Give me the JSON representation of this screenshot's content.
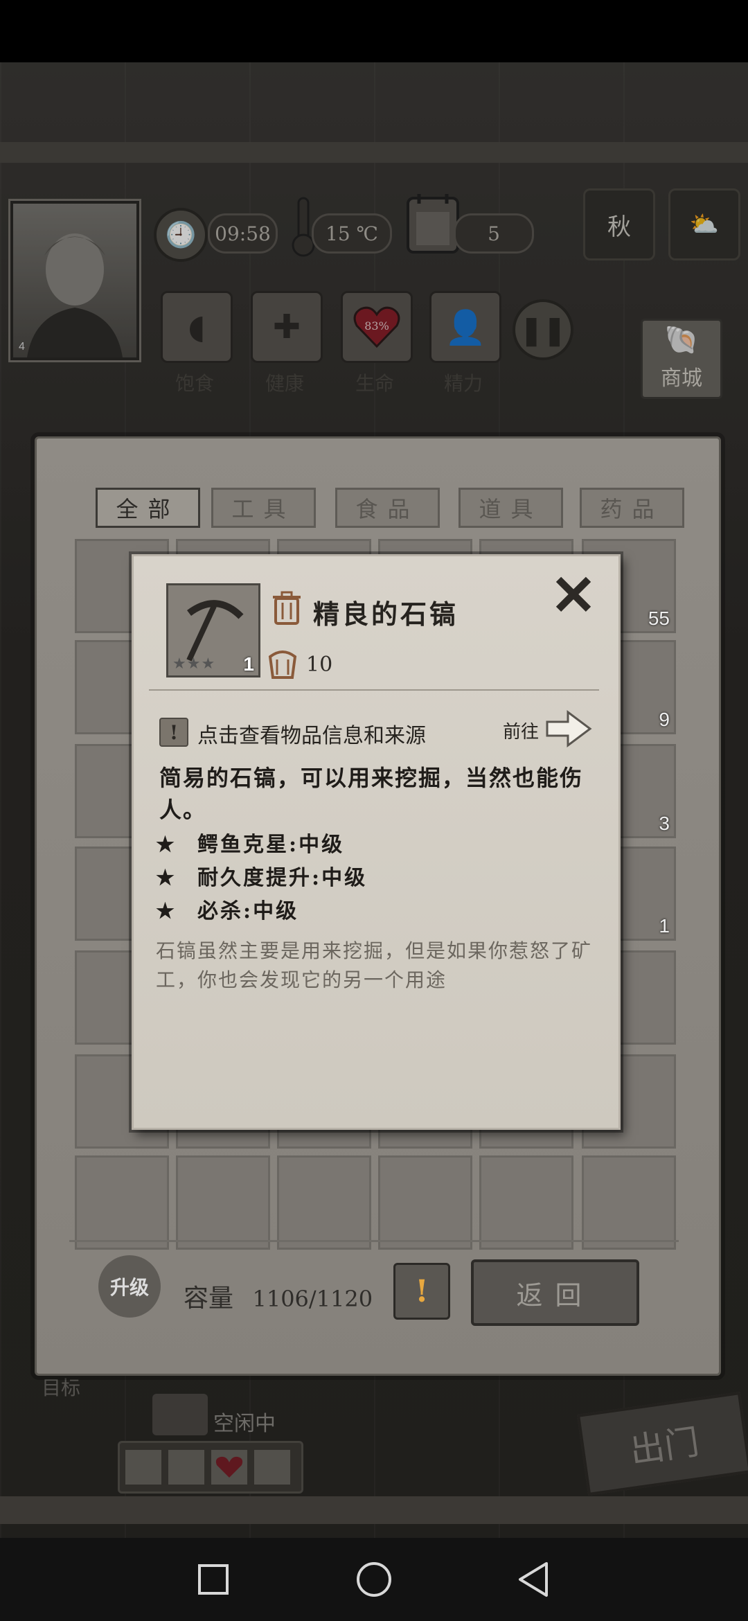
{
  "hud": {
    "portrait_level": "4",
    "time": "09:58",
    "temperature": "15 ℃",
    "day": "5",
    "season": "秋",
    "weather_icon": "cloudy-sun-icon",
    "stats": [
      {
        "label": "饱食",
        "icon": "stomach-icon"
      },
      {
        "label": "健康",
        "icon": "health-cross-icon"
      },
      {
        "label": "生命",
        "icon": "heart-icon",
        "value": "83%"
      },
      {
        "label": "精力",
        "icon": "person-icon"
      }
    ],
    "shop_label": "商城"
  },
  "inventory": {
    "tabs": [
      {
        "label": "全部",
        "active": true
      },
      {
        "label": "工具",
        "active": false
      },
      {
        "label": "食品",
        "active": false
      },
      {
        "label": "道具",
        "active": false
      },
      {
        "label": "药品",
        "active": false
      }
    ],
    "visible_counts": {
      "herb": "55",
      "stone": "9",
      "food": "3",
      "pickaxe": "1"
    },
    "upgrade_label": "升级",
    "capacity_label": "容量",
    "capacity_value": "1106/1120",
    "back_label": "返回"
  },
  "item_detail": {
    "name": "精良的石镐",
    "quantity": "1",
    "stars": "★★★",
    "weight": "10",
    "info_link": "点击查看物品信息和来源",
    "goto_label": "前往",
    "description": "简易的石镐，可以用来挖掘，当然也能伤人。",
    "attributes": [
      "鳄鱼克星:中级",
      "耐久度提升:中级",
      "必杀:中级"
    ],
    "flavor_text": "石镐虽然主要是用来挖掘，但是如果你惹怒了矿工，你也会发现它的另一个用途"
  },
  "lower": {
    "goal_label": "目标",
    "worker_status": "空闲中",
    "exit_label": "出门"
  }
}
